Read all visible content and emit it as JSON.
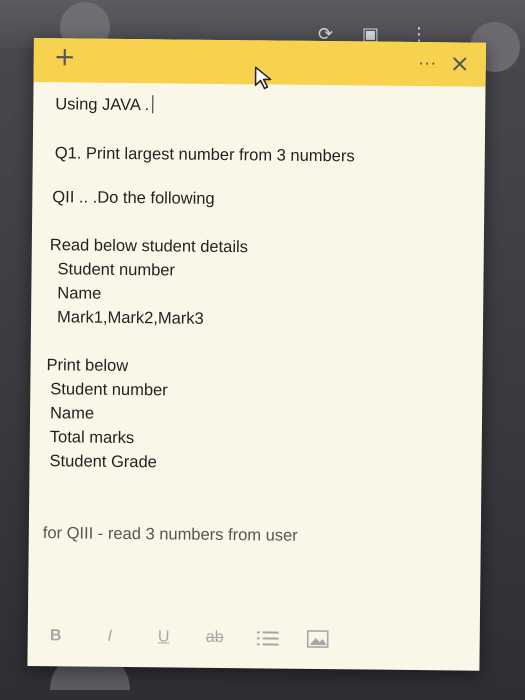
{
  "note": {
    "add_icon": "plus-icon",
    "menu_icon": "more-icon",
    "close_icon": "close-icon",
    "menu_label": "···",
    "lines": {
      "l1": "Using JAVA .",
      "l2": "Q1. Print largest number from 3 numbers",
      "l3": "QII ..  .Do the following",
      "l4": "Read below student details",
      "l5": "Student number",
      "l6": "Name",
      "l7": "Mark1,Mark2,Mark3",
      "l8": "Print below",
      "l9": "Student number",
      "l10": "Name",
      "l11": "Total marks",
      "l12": "Student  Grade",
      "l13": "for QIII  - read 3 numbers from user"
    }
  },
  "toolbar": {
    "bold": "B",
    "italic": "I",
    "underline": "U",
    "strike": "ab",
    "list_icon": "list-icon",
    "image_icon": "image-icon"
  },
  "colors": {
    "header": "#f7d24f",
    "note_bg": "#fbf7e8",
    "toolbar_text": "#a7a7a7"
  }
}
